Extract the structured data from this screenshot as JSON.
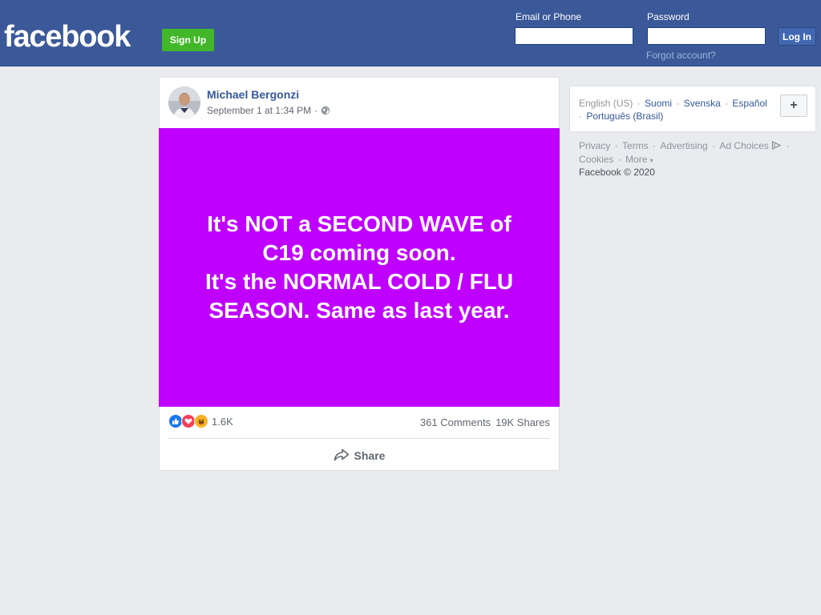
{
  "header": {
    "logo": "facebook",
    "signup_label": "Sign Up",
    "email_label": "Email or Phone",
    "password_label": "Password",
    "email_value": "",
    "password_value": "",
    "login_label": "Log In",
    "forgot_label": "Forgot account?"
  },
  "post": {
    "author": "Michael Bergonzi",
    "timestamp": "September 1 at 1:34 PM",
    "meta_sep": "·",
    "image_lines": [
      "It's NOT a SECOND WAVE of",
      "C19 coming soon.",
      "It's the NORMAL COLD / FLU",
      "SEASON. Same as last year."
    ],
    "image_bg": "#bf00ff",
    "reaction_icons": [
      "like-icon",
      "love-icon",
      "haha-icon"
    ],
    "reaction_count": "1.6K",
    "comments": "361 Comments",
    "shares": "19K Shares",
    "share_label": "Share"
  },
  "sidebar": {
    "languages": {
      "current": "English (US)",
      "others": [
        "Suomi",
        "Svenska",
        "Español",
        "Português (Brasil)"
      ]
    },
    "add_language": "+",
    "footer_links": [
      "Privacy",
      "Terms",
      "Advertising",
      "Ad Choices",
      "Cookies",
      "More"
    ],
    "copyright": "Facebook © 2020"
  },
  "colors": {
    "brand": "#3b5998",
    "signup": "#42b72a",
    "link": "#365899"
  }
}
